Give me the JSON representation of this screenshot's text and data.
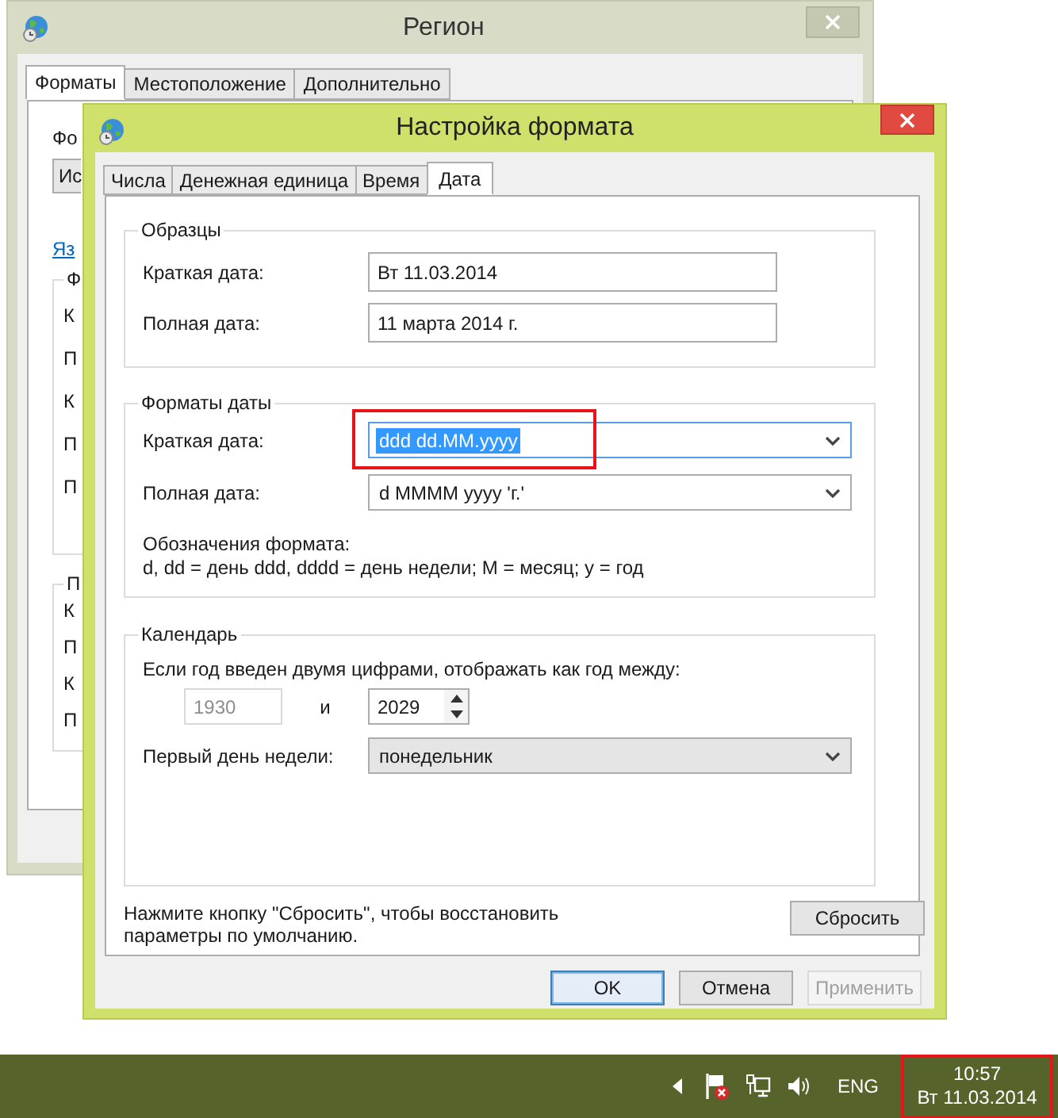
{
  "back_window": {
    "title": "Регион",
    "tabs": [
      {
        "label": "Форматы",
        "selected": true
      },
      {
        "label": "Местоположение",
        "selected": false
      },
      {
        "label": "Дополнительно",
        "selected": false
      }
    ],
    "format_label": "Фо",
    "format_dropdown": "Ис",
    "language_link": "Яз",
    "groups": [
      {
        "title": "Ф",
        "items": [
          "К",
          "П",
          "К",
          "П",
          "П"
        ]
      },
      {
        "title": "П",
        "items": [
          "К",
          "П",
          "К",
          "П"
        ]
      }
    ]
  },
  "dialog": {
    "title": "Настройка формата",
    "tabs": [
      {
        "label": "Числа",
        "selected": false
      },
      {
        "label": "Денежная единица",
        "selected": false
      },
      {
        "label": "Время",
        "selected": false
      },
      {
        "label": "Дата",
        "selected": true
      }
    ],
    "samples": {
      "title": "Образцы",
      "rows": [
        {
          "label": "Краткая дата:",
          "value": "Вт 11.03.2014"
        },
        {
          "label": "Полная дата:",
          "value": "11 марта 2014 г."
        }
      ]
    },
    "date_formats": {
      "title": "Форматы даты",
      "rows": [
        {
          "label": "Краткая дата:",
          "value": "ddd dd.MM.yyyy",
          "focused": true,
          "text_selected": true
        },
        {
          "label": "Полная дата:",
          "value": "d MMMM yyyy 'г.'",
          "focused": false,
          "text_selected": false
        }
      ],
      "legend_title": "Обозначения формата:",
      "legend": "d, dd = день  ddd, dddd = день недели; M = месяц; y = год"
    },
    "calendar": {
      "title": "Календарь",
      "two_digit_label": "Если год введен двумя цифрами, отображать как год между:",
      "from_year": {
        "value": "1930",
        "disabled": true
      },
      "and": "и",
      "to_year": "2029",
      "first_day_label": "Первый день недели:",
      "first_day": "понедельник"
    },
    "reset_note": [
      "Нажмите кнопку \"Сбросить\", чтобы восстановить",
      "параметры по умолчанию."
    ],
    "reset_button": "Сбросить",
    "buttons": [
      {
        "label": "OK",
        "kind": "default"
      },
      {
        "label": "Отмена",
        "kind": "normal"
      },
      {
        "label": "Применить",
        "kind": "disabled"
      }
    ]
  },
  "taskbar": {
    "language": "ENG",
    "time": "10:57",
    "date": "Вт 11.03.2014"
  }
}
